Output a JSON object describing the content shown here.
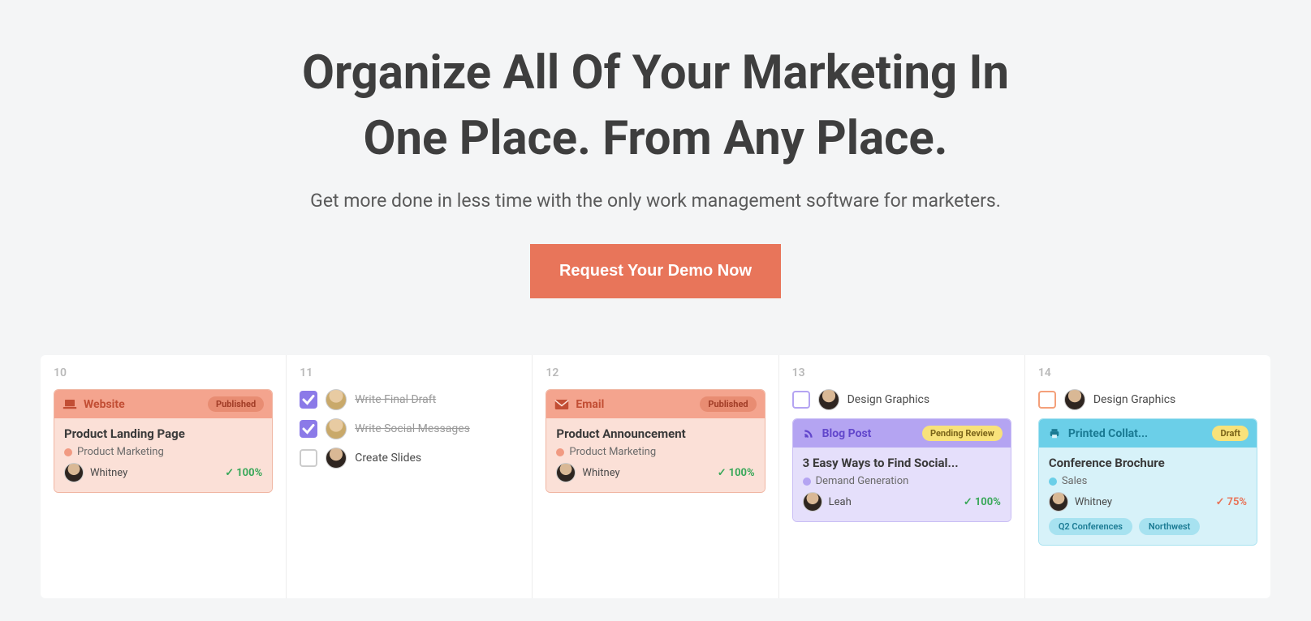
{
  "hero": {
    "title_line1": "Organize All Of Your Marketing In",
    "title_line2": "One Place. From Any Place.",
    "subtitle": "Get more done in less time with the only work management software for marketers.",
    "cta_label": "Request Your Demo Now"
  },
  "columns": [
    {
      "day": "10",
      "tasks": [],
      "cards": [
        {
          "scheme": "salmon",
          "icon": "laptop-icon",
          "type_label": "Website",
          "status_label": "Published",
          "title": "Product Landing Page",
          "tag_label": "Product Marketing",
          "tag_color": "#f19a82",
          "owner": "Whitney",
          "owner_avatar": "dark",
          "pct": "100%",
          "pct_style": "green",
          "pills": []
        }
      ]
    },
    {
      "day": "11",
      "tasks": [
        {
          "checked": true,
          "check_style": "purple",
          "avatar": "blonde",
          "label": "Write Final Draft"
        },
        {
          "checked": true,
          "check_style": "purple",
          "avatar": "blonde",
          "label": "Write Social Messages"
        },
        {
          "checked": false,
          "check_style": "plain",
          "avatar": "dark",
          "label": "Create Slides"
        }
      ],
      "cards": []
    },
    {
      "day": "12",
      "tasks": [],
      "cards": [
        {
          "scheme": "salmon",
          "icon": "envelope-icon",
          "type_label": "Email",
          "status_label": "Published",
          "title": "Product Announcement",
          "tag_label": "Product Marketing",
          "tag_color": "#f19a82",
          "owner": "Whitney",
          "owner_avatar": "dark",
          "pct": "100%",
          "pct_style": "green",
          "pills": []
        }
      ]
    },
    {
      "day": "13",
      "tasks": [
        {
          "checked": false,
          "check_style": "purple-border",
          "avatar": "dark",
          "label": "Design Graphics"
        }
      ],
      "cards": [
        {
          "scheme": "purple",
          "icon": "rss-icon",
          "type_label": "Blog Post",
          "status_label": "Pending Review",
          "title": "3 Easy Ways to Find Social...",
          "tag_label": "Demand Generation",
          "tag_color": "#b4a4f2",
          "owner": "Leah",
          "owner_avatar": "dark",
          "pct": "100%",
          "pct_style": "green",
          "pills": []
        }
      ]
    },
    {
      "day": "14",
      "tasks": [
        {
          "checked": false,
          "check_style": "orange-border",
          "avatar": "dark",
          "label": "Design Graphics"
        }
      ],
      "cards": [
        {
          "scheme": "cyan",
          "icon": "printer-icon",
          "type_label": "Printed Collat...",
          "status_label": "Draft",
          "title": "Conference Brochure",
          "tag_label": "Sales",
          "tag_color": "#6bcfe8",
          "owner": "Whitney",
          "owner_avatar": "dark",
          "pct": "75%",
          "pct_style": "orange",
          "pills": [
            "Q2 Conferences",
            "Northwest"
          ]
        }
      ]
    }
  ]
}
